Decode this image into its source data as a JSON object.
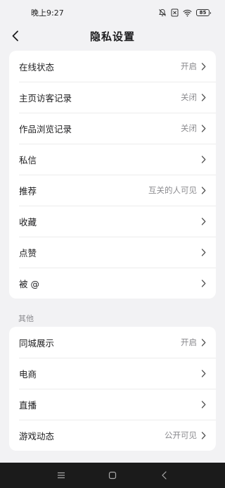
{
  "status_bar": {
    "time": "晚上9:27",
    "battery": "85",
    "icons": [
      "mute-icon",
      "sim-icon",
      "wifi-icon",
      "battery-icon"
    ]
  },
  "header": {
    "title": "隐私设置",
    "back_icon": "chevron-left-icon"
  },
  "group1": {
    "items": [
      {
        "label": "在线状态",
        "value": "开启"
      },
      {
        "label": "主页访客记录",
        "value": "关闭"
      },
      {
        "label": "作品浏览记录",
        "value": "关闭"
      },
      {
        "label": "私信",
        "value": ""
      },
      {
        "label": "推荐",
        "value": "互关的人可见"
      },
      {
        "label": "收藏",
        "value": ""
      },
      {
        "label": "点赞",
        "value": ""
      },
      {
        "label": "被 @",
        "value": ""
      }
    ]
  },
  "group2": {
    "title": "其他",
    "items": [
      {
        "label": "同城展示",
        "value": "开启"
      },
      {
        "label": "电商",
        "value": ""
      },
      {
        "label": "直播",
        "value": ""
      },
      {
        "label": "游戏动态",
        "value": "公开可见"
      }
    ]
  },
  "system_nav": [
    "menu-icon",
    "home-icon",
    "back-icon"
  ]
}
